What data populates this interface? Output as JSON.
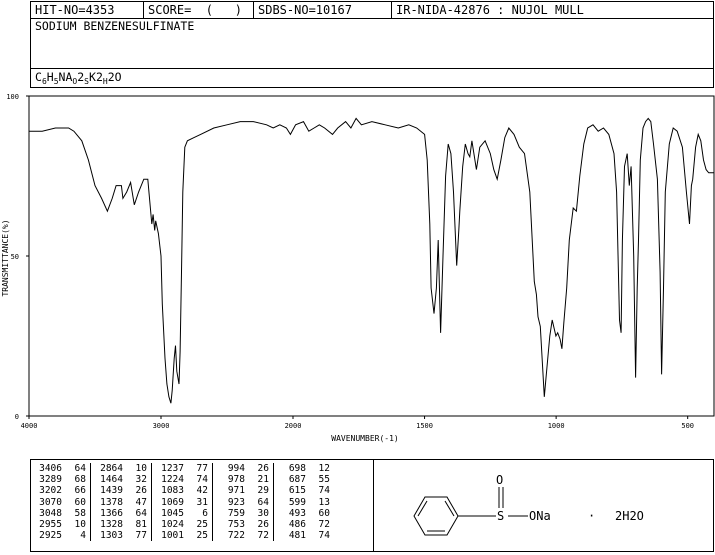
{
  "header": {
    "hit_no": "HIT-NO=4353",
    "score": "SCORE=  (   )",
    "sdbs_no": "SDBS-NO=10167",
    "ir_nida": "IR-NIDA-42876 : NUJOL MULL"
  },
  "compound_name": "SODIUM BENZENESULFINATE",
  "formula": "C6H5NAO2SK2H2O",
  "structure": {
    "sulfur_label": "S",
    "oxygen_label": "O",
    "substituent_label": "ONa",
    "dot": "·",
    "water_label": "2H2O"
  },
  "chart_data": {
    "type": "line",
    "title": "",
    "xlabel": "WAVENUMBER(-1)",
    "ylabel": "TRANSMITTANCE(%)",
    "xlim": [
      4000,
      400
    ],
    "ylim": [
      0,
      100
    ],
    "x_ticks": [
      4000,
      3000,
      2000,
      1500,
      1000,
      500
    ],
    "y_ticks": [
      0,
      50,
      100
    ],
    "grid": false,
    "series": [
      {
        "points": [
          [
            4000,
            89
          ],
          [
            3900,
            89
          ],
          [
            3800,
            90
          ],
          [
            3700,
            90
          ],
          [
            3660,
            89
          ],
          [
            3600,
            86
          ],
          [
            3550,
            80
          ],
          [
            3500,
            72
          ],
          [
            3450,
            68
          ],
          [
            3406,
            64
          ],
          [
            3370,
            68
          ],
          [
            3340,
            72
          ],
          [
            3300,
            72
          ],
          [
            3289,
            68
          ],
          [
            3260,
            70
          ],
          [
            3230,
            73
          ],
          [
            3202,
            66
          ],
          [
            3170,
            70
          ],
          [
            3130,
            74
          ],
          [
            3100,
            74
          ],
          [
            3070,
            60
          ],
          [
            3060,
            63
          ],
          [
            3048,
            58
          ],
          [
            3040,
            61
          ],
          [
            3020,
            57
          ],
          [
            3000,
            50
          ],
          [
            2990,
            35
          ],
          [
            2970,
            18
          ],
          [
            2955,
            10
          ],
          [
            2940,
            6
          ],
          [
            2925,
            4
          ],
          [
            2915,
            8
          ],
          [
            2900,
            18
          ],
          [
            2890,
            22
          ],
          [
            2880,
            14
          ],
          [
            2864,
            10
          ],
          [
            2855,
            20
          ],
          [
            2845,
            45
          ],
          [
            2835,
            70
          ],
          [
            2820,
            84
          ],
          [
            2800,
            86
          ],
          [
            2750,
            87
          ],
          [
            2700,
            88
          ],
          [
            2600,
            90
          ],
          [
            2500,
            91
          ],
          [
            2400,
            92
          ],
          [
            2300,
            92
          ],
          [
            2200,
            91
          ],
          [
            2150,
            90
          ],
          [
            2100,
            91
          ],
          [
            2050,
            90
          ],
          [
            2020,
            88
          ],
          [
            1990,
            91
          ],
          [
            1960,
            92
          ],
          [
            1940,
            89
          ],
          [
            1920,
            90
          ],
          [
            1900,
            91
          ],
          [
            1880,
            90
          ],
          [
            1850,
            88
          ],
          [
            1830,
            90
          ],
          [
            1800,
            92
          ],
          [
            1780,
            90
          ],
          [
            1760,
            93
          ],
          [
            1740,
            91
          ],
          [
            1700,
            92
          ],
          [
            1650,
            91
          ],
          [
            1600,
            90
          ],
          [
            1560,
            91
          ],
          [
            1530,
            90
          ],
          [
            1500,
            88
          ],
          [
            1490,
            80
          ],
          [
            1480,
            60
          ],
          [
            1475,
            40
          ],
          [
            1464,
            32
          ],
          [
            1455,
            40
          ],
          [
            1448,
            55
          ],
          [
            1439,
            26
          ],
          [
            1430,
            50
          ],
          [
            1420,
            75
          ],
          [
            1410,
            85
          ],
          [
            1400,
            82
          ],
          [
            1390,
            70
          ],
          [
            1378,
            47
          ],
          [
            1370,
            58
          ],
          [
            1366,
            64
          ],
          [
            1355,
            78
          ],
          [
            1345,
            85
          ],
          [
            1335,
            82
          ],
          [
            1328,
            81
          ],
          [
            1320,
            86
          ],
          [
            1303,
            77
          ],
          [
            1290,
            84
          ],
          [
            1270,
            86
          ],
          [
            1250,
            82
          ],
          [
            1237,
            77
          ],
          [
            1224,
            74
          ],
          [
            1210,
            80
          ],
          [
            1195,
            87
          ],
          [
            1180,
            90
          ],
          [
            1160,
            88
          ],
          [
            1140,
            84
          ],
          [
            1120,
            82
          ],
          [
            1100,
            70
          ],
          [
            1083,
            42
          ],
          [
            1075,
            38
          ],
          [
            1069,
            31
          ],
          [
            1060,
            28
          ],
          [
            1045,
            6
          ],
          [
            1035,
            15
          ],
          [
            1024,
            25
          ],
          [
            1015,
            30
          ],
          [
            1001,
            25
          ],
          [
            994,
            26
          ],
          [
            985,
            24
          ],
          [
            978,
            21
          ],
          [
            971,
            29
          ],
          [
            960,
            40
          ],
          [
            950,
            55
          ],
          [
            935,
            65
          ],
          [
            923,
            64
          ],
          [
            910,
            75
          ],
          [
            895,
            85
          ],
          [
            880,
            90
          ],
          [
            860,
            91
          ],
          [
            840,
            89
          ],
          [
            820,
            90
          ],
          [
            800,
            88
          ],
          [
            780,
            82
          ],
          [
            770,
            70
          ],
          [
            759,
            30
          ],
          [
            753,
            26
          ],
          [
            748,
            55
          ],
          [
            740,
            78
          ],
          [
            730,
            82
          ],
          [
            722,
            72
          ],
          [
            715,
            78
          ],
          [
            705,
            50
          ],
          [
            698,
            12
          ],
          [
            692,
            40
          ],
          [
            687,
            55
          ],
          [
            680,
            80
          ],
          [
            670,
            90
          ],
          [
            660,
            92
          ],
          [
            650,
            93
          ],
          [
            640,
            92
          ],
          [
            630,
            85
          ],
          [
            615,
            74
          ],
          [
            605,
            45
          ],
          [
            599,
            13
          ],
          [
            592,
            40
          ],
          [
            585,
            70
          ],
          [
            570,
            85
          ],
          [
            555,
            90
          ],
          [
            540,
            89
          ],
          [
            520,
            84
          ],
          [
            505,
            70
          ],
          [
            493,
            60
          ],
          [
            486,
            72
          ],
          [
            481,
            74
          ],
          [
            470,
            84
          ],
          [
            460,
            88
          ],
          [
            450,
            86
          ],
          [
            440,
            80
          ],
          [
            430,
            77
          ],
          [
            420,
            76
          ],
          [
            400,
            76
          ]
        ]
      }
    ]
  },
  "peak_table": [
    [
      [
        "3406",
        "64"
      ],
      [
        "2864",
        "10"
      ],
      [
        "1237",
        "77"
      ],
      [
        "994",
        "26"
      ],
      [
        "698",
        "12"
      ]
    ],
    [
      [
        "3289",
        "68"
      ],
      [
        "1464",
        "32"
      ],
      [
        "1224",
        "74"
      ],
      [
        "978",
        "21"
      ],
      [
        "687",
        "55"
      ]
    ],
    [
      [
        "3202",
        "66"
      ],
      [
        "1439",
        "26"
      ],
      [
        "1083",
        "42"
      ],
      [
        "971",
        "29"
      ],
      [
        "615",
        "74"
      ]
    ],
    [
      [
        "3070",
        "60"
      ],
      [
        "1378",
        "47"
      ],
      [
        "1069",
        "31"
      ],
      [
        "923",
        "64"
      ],
      [
        "599",
        "13"
      ]
    ],
    [
      [
        "3048",
        "58"
      ],
      [
        "1366",
        "64"
      ],
      [
        "1045",
        "6"
      ],
      [
        "759",
        "30"
      ],
      [
        "493",
        "60"
      ]
    ],
    [
      [
        "2955",
        "10"
      ],
      [
        "1328",
        "81"
      ],
      [
        "1024",
        "25"
      ],
      [
        "753",
        "26"
      ],
      [
        "486",
        "72"
      ]
    ],
    [
      [
        "2925",
        "4"
      ],
      [
        "1303",
        "77"
      ],
      [
        "1001",
        "25"
      ],
      [
        "722",
        "72"
      ],
      [
        "481",
        "74"
      ]
    ]
  ]
}
